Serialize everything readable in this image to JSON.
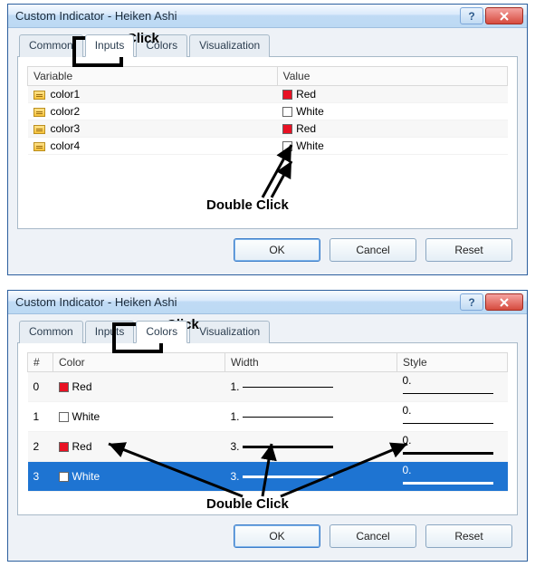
{
  "annotations": {
    "click1": "Click",
    "dbl1": "Double Click",
    "click2": "Click",
    "dbl2": "Double Click"
  },
  "dialog1": {
    "title": "Custom Indicator - Heiken Ashi",
    "help": "?",
    "tabs": {
      "common": "Common",
      "inputs": "Inputs",
      "colors": "Colors",
      "visualization": "Visualization"
    },
    "headers": {
      "variable": "Variable",
      "value": "Value"
    },
    "rows": [
      {
        "name": "color1",
        "color": "#e81123",
        "label": "Red"
      },
      {
        "name": "color2",
        "color": "#ffffff",
        "label": "White"
      },
      {
        "name": "color3",
        "color": "#e81123",
        "label": "Red"
      },
      {
        "name": "color4",
        "color": "#ffffff",
        "label": "White"
      }
    ],
    "buttons": {
      "ok": "OK",
      "cancel": "Cancel",
      "reset": "Reset"
    }
  },
  "dialog2": {
    "title": "Custom Indicator - Heiken Ashi",
    "help": "?",
    "tabs": {
      "common": "Common",
      "inputs": "Inputs",
      "colors": "Colors",
      "visualization": "Visualization"
    },
    "headers": {
      "num": "#",
      "color": "Color",
      "width": "Width",
      "style": "Style"
    },
    "rows": [
      {
        "num": "0",
        "color": "#e81123",
        "label": "Red",
        "width": "1.",
        "style": "0."
      },
      {
        "num": "1",
        "color": "#ffffff",
        "label": "White",
        "width": "1.",
        "style": "0."
      },
      {
        "num": "2",
        "color": "#e81123",
        "label": "Red",
        "width": "3.",
        "style": "0."
      },
      {
        "num": "3",
        "color": "#ffffff",
        "label": "White",
        "width": "3.",
        "style": "0."
      }
    ],
    "buttons": {
      "ok": "OK",
      "cancel": "Cancel",
      "reset": "Reset"
    }
  }
}
